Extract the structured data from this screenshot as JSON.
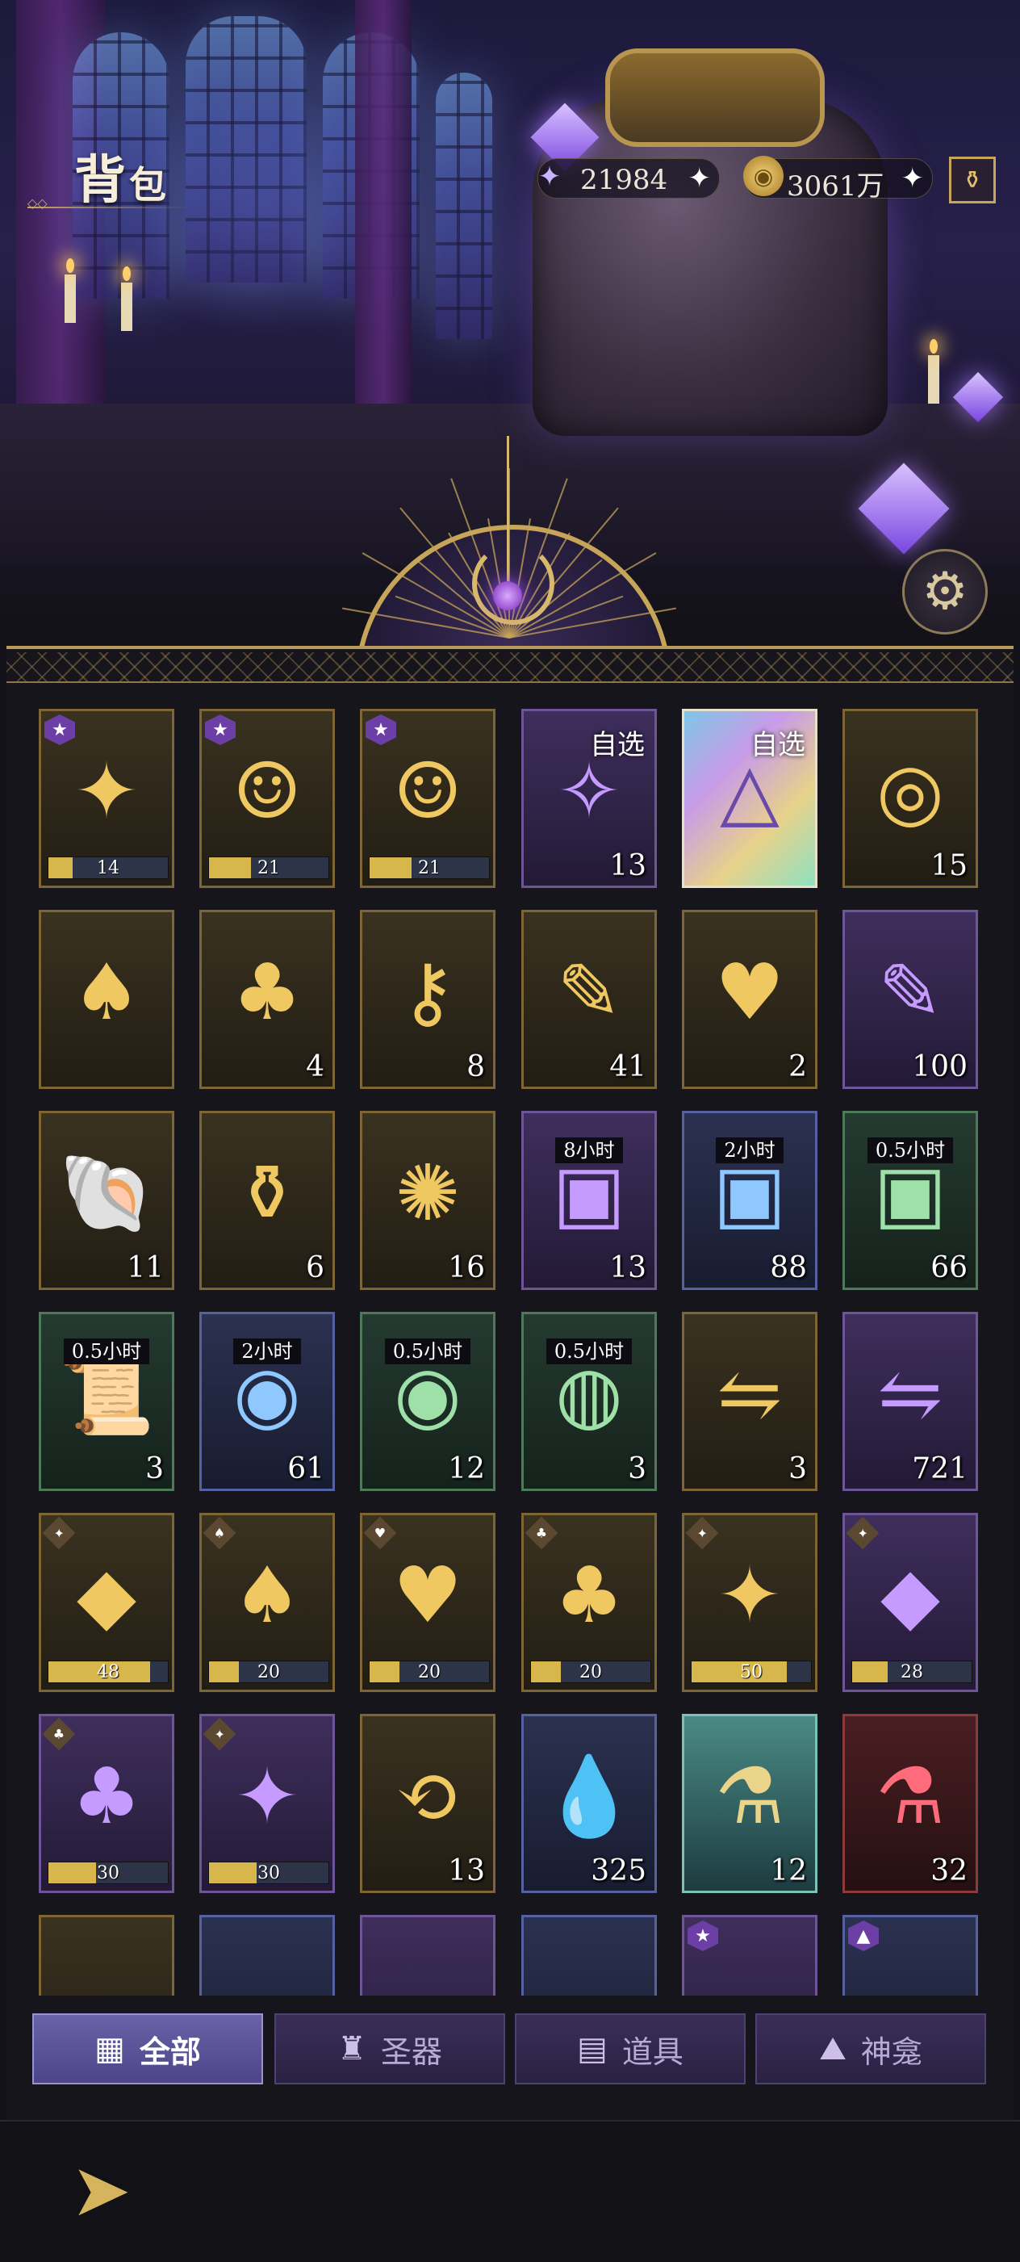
{
  "header": {
    "title_main": "背",
    "title_sub": "包",
    "currencies": [
      {
        "icon": "star-crystal-icon",
        "value": "21984",
        "plus": "✦"
      },
      {
        "icon": "gold-coin-icon",
        "value": "3061万",
        "plus": "✦"
      }
    ],
    "shop_icon": "potion-shop-icon",
    "settings_icon": "gear-icon"
  },
  "items": [
    {
      "icon": "✦",
      "name": "silver-hair-portrait-puzzle",
      "rarity": "gold",
      "bar": {
        "label": "14",
        "pct": 0.2
      },
      "star": "★"
    },
    {
      "icon": "☺",
      "name": "lady-portrait-puzzle",
      "rarity": "gold",
      "bar": {
        "label": "21",
        "pct": 0.35
      },
      "star": "★"
    },
    {
      "icon": "☺",
      "name": "dark-hair-portrait-puzzle",
      "rarity": "gold",
      "bar": {
        "label": "21",
        "pct": 0.35
      },
      "star": "★"
    },
    {
      "icon": "✧",
      "name": "tarot-card-selector",
      "rarity": "purple",
      "count": "13",
      "pick": "自选"
    },
    {
      "icon": "△",
      "name": "rainbow-triangle-selector",
      "rarity": "rainbow",
      "pick": "自选"
    },
    {
      "icon": "◎",
      "name": "crystal-ring",
      "rarity": "gold",
      "count": "15"
    },
    {
      "icon": "♠",
      "name": "spade-quill",
      "rarity": "gold"
    },
    {
      "icon": "♣",
      "name": "club-quill",
      "rarity": "gold",
      "count": "4"
    },
    {
      "icon": "⚷",
      "name": "gem-key",
      "rarity": "gold",
      "count": "8"
    },
    {
      "icon": "✎",
      "name": "golden-feather",
      "rarity": "gold",
      "count": "41"
    },
    {
      "icon": "♥",
      "name": "heart-quill",
      "rarity": "gold",
      "count": "2"
    },
    {
      "icon": "✎",
      "name": "dark-feather",
      "rarity": "purple",
      "count": "100"
    },
    {
      "icon": "🐚",
      "name": "conch-shell",
      "rarity": "gold",
      "count": "11"
    },
    {
      "icon": "⚱",
      "name": "pearl-vase",
      "rarity": "gold",
      "count": "6"
    },
    {
      "icon": "✺",
      "name": "fireworks",
      "rarity": "gold",
      "count": "16"
    },
    {
      "icon": "▣",
      "name": "chest-8h",
      "rarity": "purple",
      "count": "13",
      "badge": "8小时"
    },
    {
      "icon": "▣",
      "name": "chest-2h",
      "rarity": "blue",
      "count": "88",
      "badge": "2小时"
    },
    {
      "icon": "▣",
      "name": "chest-0.5h",
      "rarity": "green",
      "count": "66",
      "badge": "0.5小时"
    },
    {
      "icon": "📜",
      "name": "scroll-0.5h",
      "rarity": "green",
      "count": "3",
      "badge": "0.5小时"
    },
    {
      "icon": "◉",
      "name": "exp-bag-2h",
      "rarity": "blue",
      "count": "61",
      "badge": "2小时"
    },
    {
      "icon": "◉",
      "name": "exp-orbs-0.5h",
      "rarity": "green",
      "count": "12",
      "badge": "0.5小时"
    },
    {
      "icon": "◍",
      "name": "coin-stack-0.5h",
      "rarity": "green",
      "count": "3",
      "badge": "0.5小时"
    },
    {
      "icon": "⇋",
      "name": "purple-token",
      "rarity": "gold",
      "count": "3"
    },
    {
      "icon": "⇋",
      "name": "blue-token",
      "rarity": "purple",
      "count": "721"
    },
    {
      "icon": "◆",
      "name": "gold-keyhole-crystal",
      "rarity": "gold",
      "bar": {
        "label": "48",
        "pct": 0.85
      },
      "suit": "✦"
    },
    {
      "icon": "♠",
      "name": "gold-spade-crystal",
      "rarity": "gold",
      "bar": {
        "label": "20",
        "pct": 0.25
      },
      "suit": "♠"
    },
    {
      "icon": "♥",
      "name": "gold-heart-crystal",
      "rarity": "gold",
      "bar": {
        "label": "20",
        "pct": 0.25
      },
      "suit": "♥"
    },
    {
      "icon": "♣",
      "name": "gold-club-crystal",
      "rarity": "gold",
      "bar": {
        "label": "20",
        "pct": 0.25
      },
      "suit": "♣"
    },
    {
      "icon": "✦",
      "name": "gold-star-crystal",
      "rarity": "gold",
      "bar": {
        "label": "50",
        "pct": 0.8
      },
      "suit": "✦"
    },
    {
      "icon": "◆",
      "name": "purple-keyhole-crystal",
      "rarity": "purple",
      "bar": {
        "label": "28",
        "pct": 0.3
      },
      "suit": "✦"
    },
    {
      "icon": "♣",
      "name": "purple-club-crystal",
      "rarity": "purple",
      "bar": {
        "label": "30",
        "pct": 0.4
      },
      "suit": "♣"
    },
    {
      "icon": "✦",
      "name": "purple-star-crystal",
      "rarity": "purple",
      "bar": {
        "label": "30",
        "pct": 0.4
      },
      "suit": "✦"
    },
    {
      "icon": "⟲",
      "name": "gold-exchange-gem",
      "rarity": "gold",
      "count": "13"
    },
    {
      "icon": "💧",
      "name": "blue-teardrop-gem",
      "rarity": "blue",
      "count": "325"
    },
    {
      "icon": "⚗",
      "name": "crystal-amulet",
      "rarity": "teal",
      "count": "12"
    },
    {
      "icon": "⚗",
      "name": "ruby-amulet",
      "rarity": "red",
      "count": "32"
    },
    {
      "icon": "",
      "name": "partial-item-1",
      "rarity": "gold"
    },
    {
      "icon": "",
      "name": "partial-item-2",
      "rarity": "blue"
    },
    {
      "icon": "",
      "name": "partial-item-3",
      "rarity": "purple"
    },
    {
      "icon": "",
      "name": "partial-item-4",
      "rarity": "blue"
    },
    {
      "icon": "",
      "name": "partial-item-5",
      "rarity": "purple",
      "star": "★"
    },
    {
      "icon": "",
      "name": "partial-item-6",
      "rarity": "blue",
      "star": "▲"
    }
  ],
  "tabs": [
    {
      "label": "全部",
      "icon": "▦",
      "active": true
    },
    {
      "label": "圣器",
      "icon": "♜",
      "active": false
    },
    {
      "label": "道具",
      "icon": "▤",
      "active": false
    },
    {
      "label": "神龛",
      "icon": "⛰",
      "active": false
    }
  ],
  "back_icon": "back-arrow-icon",
  "colors": {
    "gold": "#c6a458",
    "active_tab": "#6a62a8",
    "bar_fill": "#d7b64b"
  }
}
